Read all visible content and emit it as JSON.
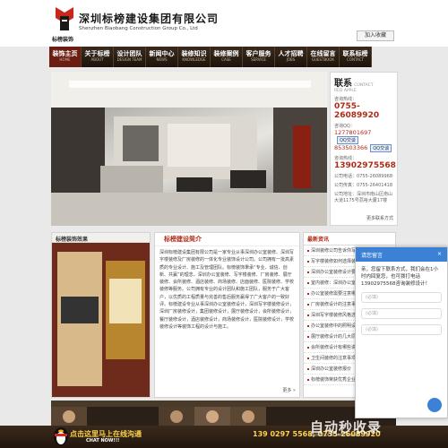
{
  "header": {
    "company_cn": "深圳标榜建设集团有限公司",
    "company_en": "Shenzhen Biaobang Construction Group Co., Ltd",
    "brand": "标榜装饰",
    "favorite_label": "加入收藏"
  },
  "nav": {
    "items": [
      {
        "cn": "装饰主页",
        "en": "HOME"
      },
      {
        "cn": "关于标榜",
        "en": "ABOUT"
      },
      {
        "cn": "设计团队",
        "en": "DESIGN TEAM"
      },
      {
        "cn": "新闻中心",
        "en": "NEWS"
      },
      {
        "cn": "装修知识",
        "en": "KNOWLEDGE"
      },
      {
        "cn": "装修案例",
        "en": "CASE"
      },
      {
        "cn": "客户服务",
        "en": "SERVICE"
      },
      {
        "cn": "人才招聘",
        "en": "JOBS"
      },
      {
        "cn": "在线留言",
        "en": "GUESTBOOK"
      },
      {
        "cn": "联系标榜",
        "en": "CONTACT"
      }
    ]
  },
  "contact": {
    "title": "联系",
    "title_en": "CONTACT",
    "title_en2": "RED APPLE",
    "tel_label": "咨询热线：",
    "tel": "0755-26089920",
    "qq_label": "咨询QQ：",
    "qq1": "1277801697",
    "qq2": "853503366",
    "qq_btn": "QQ交谈",
    "mobile_label": "咨询热线：",
    "mobile": "13902975568",
    "phone_label": "公司电话：",
    "phone": "0755-26089968",
    "fax_label": "公司传真：",
    "fax": "0755-26401418",
    "addr_label": "公司地址：",
    "addr": "深圳市南山区南山大道1175号荔裕大厦17楼",
    "more": "更多联系方式"
  },
  "case_box": {
    "title": "标榜装饰效果"
  },
  "about": {
    "title": "标榜建设简介",
    "body": "深圳标榜建设集团有限公司是一家专业从事深圳办公室装修、深圳写字楼装修及厂房装修的一体化专业装饰设计公司。公司拥有一批高素质的专业设计、施工及管理团队。标榜装饰秉承“专业、诚信、创新、共赢”的理念，深圳办公室装修、写字楼装修、厂房装修、展厅装修、会所装修、酒店装修、商场装修、店面装修、医院装修、学校装修等服务。公司拥有专业的设计团队和施工团队，服务于广大客户，以优质的工程质量与完善的售后服务赢得了广大客户的一致好评。标榜建设专业从事深圳办公室装修设计，深圳写字楼装修设计，深圳厂房装修设计，集团装修设计，展厅装修设计，会所装修设计，餐厅装修设计，酒店装修设计，商场装修设计，医院装修设计，学校装修设计等装饰工程的设计与施工。",
    "more": "更多 »"
  },
  "news": {
    "title": "最新资讯",
    "items": [
      "深圳装修公司告诉你写字楼装修",
      "写字楼装修如何选择装修公司",
      "深圳办公室装修设计要点",
      "室内装修：深圳办公室装修",
      "办公室装修需要注意哪些问题",
      "厂房装修设计的注意事项",
      "深圳写字楼装修风格选择",
      "办公室装修中的照明设计",
      "展厅装修设计的几大原则",
      "会所装修设计有哪些讲究",
      "卫生间装修的注意事项",
      "深圳办公室装修报价",
      "标榜装饰荣获优秀企业称号"
    ]
  },
  "popup": {
    "title": "请您留言",
    "close": "×",
    "message": "亲，您留下联系方式，我们会在1小时内回复您，也可拨打电话13902975568咨询装修设计！",
    "name_placeholder": "(必填)",
    "phone_placeholder": "(必填)",
    "content_placeholder": "(必填)"
  },
  "footer": {
    "online_cn": "点击这里马上在线沟通",
    "online_en": "CHAT NOW!!!",
    "phone_line": "139 0297 5568, 0755-26089920"
  },
  "watermark": {
    "cn": "自动秒收录",
    "en": "WWW.ZIDONGMIAOSHOULU.COM"
  },
  "colors": {
    "accent": "#b02a16",
    "nav_bg": "#2b1e13",
    "popup_blue": "#3b82d6",
    "footer_yellow": "#ffd24a"
  }
}
